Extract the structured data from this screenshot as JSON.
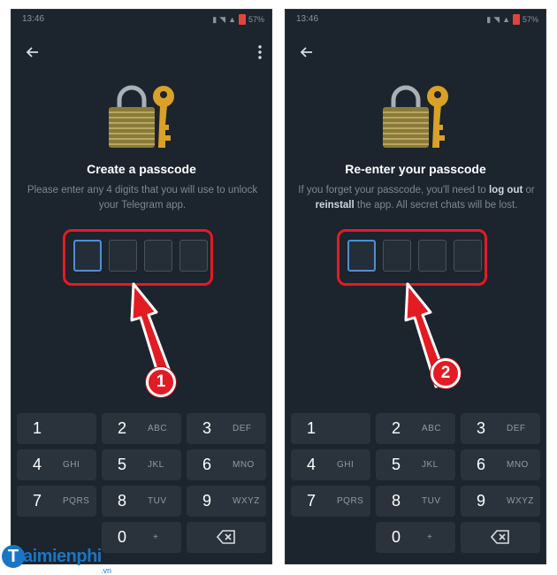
{
  "screens": [
    {
      "status_time": "13:46",
      "status_battery": "57%",
      "title": "Create a passcode",
      "description_parts": [
        "Please enter any 4 digits that you will use to unlock your Telegram app."
      ],
      "step": "1"
    },
    {
      "status_time": "13:46",
      "status_battery": "57%",
      "title": "Re-enter your passcode",
      "description_parts": [
        "If you forget your passcode, you'll need to ",
        "log out",
        " or ",
        "reinstall",
        " the app. All secret chats will be lost."
      ],
      "step": "2"
    }
  ],
  "keypad": [
    [
      {
        "num": "1",
        "letters": ""
      },
      {
        "num": "2",
        "letters": "ABC"
      },
      {
        "num": "3",
        "letters": "DEF"
      }
    ],
    [
      {
        "num": "4",
        "letters": "GHI"
      },
      {
        "num": "5",
        "letters": "JKL"
      },
      {
        "num": "6",
        "letters": "MNO"
      }
    ],
    [
      {
        "num": "7",
        "letters": "PQRS"
      },
      {
        "num": "8",
        "letters": "TUV"
      },
      {
        "num": "9",
        "letters": "WXYZ"
      }
    ],
    [
      {
        "num": "",
        "letters": ""
      },
      {
        "num": "0",
        "letters": "+"
      },
      {
        "num": "backspace",
        "letters": ""
      }
    ]
  ],
  "watermark": {
    "brand": "aimienphi",
    "initial": "T",
    "tld": ".vn"
  },
  "colors": {
    "background": "#1c242d",
    "key": "#2a333c",
    "accent": "#4d8fd6",
    "highlight": "#e31b23"
  }
}
